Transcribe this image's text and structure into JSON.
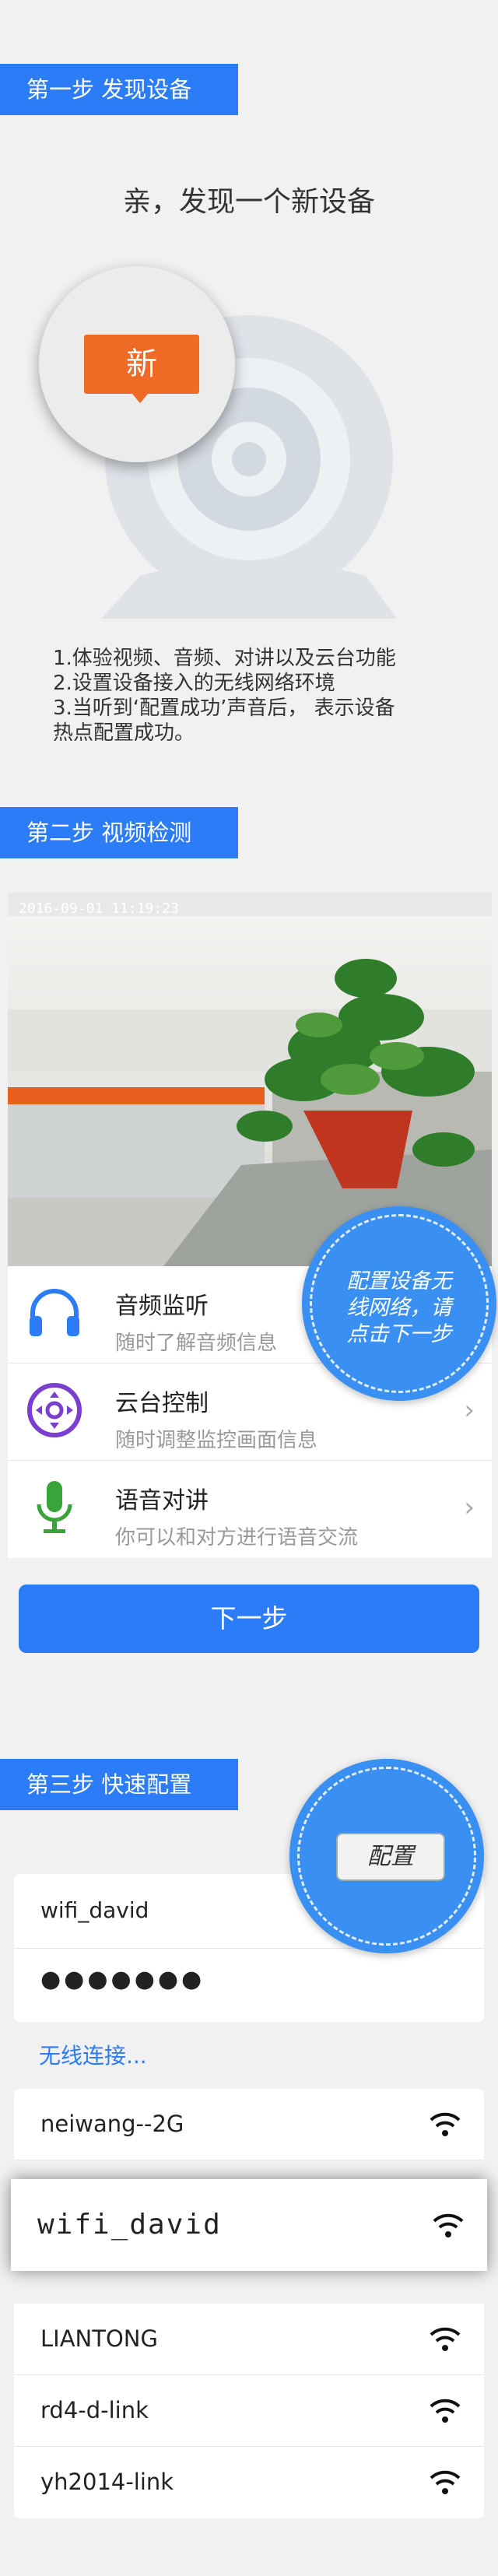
{
  "step1": {
    "tag": "第一步  发现设备",
    "heading": "亲，发现一个新设备",
    "badge": "新",
    "lines": [
      "1.体验视频、音频、对讲以及云台功能",
      "2.设置设备接入的无线网络环境",
      "3.当听到‘配置成功’声音后， 表示设备",
      "热点配置成功。"
    ]
  },
  "step2": {
    "tag": "第二步  视频检测",
    "video_timestamp": "2016-09-01 11:19:23",
    "features": [
      {
        "title": "音频监听",
        "subtitle": "随时了解音频信息",
        "icon": "headphones-icon"
      },
      {
        "title": "云台控制",
        "subtitle": "随时调整监控画面信息",
        "icon": "ptz-control-icon"
      },
      {
        "title": "语音对讲",
        "subtitle": "你可以和对方进行语音交流",
        "icon": "microphone-icon"
      }
    ],
    "callout": [
      "配置设备无",
      "线网络，请",
      "点击下一步"
    ],
    "next_button": "下一步"
  },
  "step3": {
    "tag": "第三步  快速配置",
    "config_button": "配置",
    "ssid_value": "wifi_david",
    "password_value": "●●●●●●●",
    "connecting": "无线连接...",
    "networks": [
      "neiwang--2G",
      "wifi_david",
      "LIANTONG",
      "rd4-d-link",
      "yh2014-link"
    ],
    "selected_network": "wifi_david"
  },
  "colors": {
    "accent": "#2b7cf6",
    "badge": "#ef6a25",
    "ptz": "#7a3fd0",
    "mic": "#3aa33a"
  }
}
